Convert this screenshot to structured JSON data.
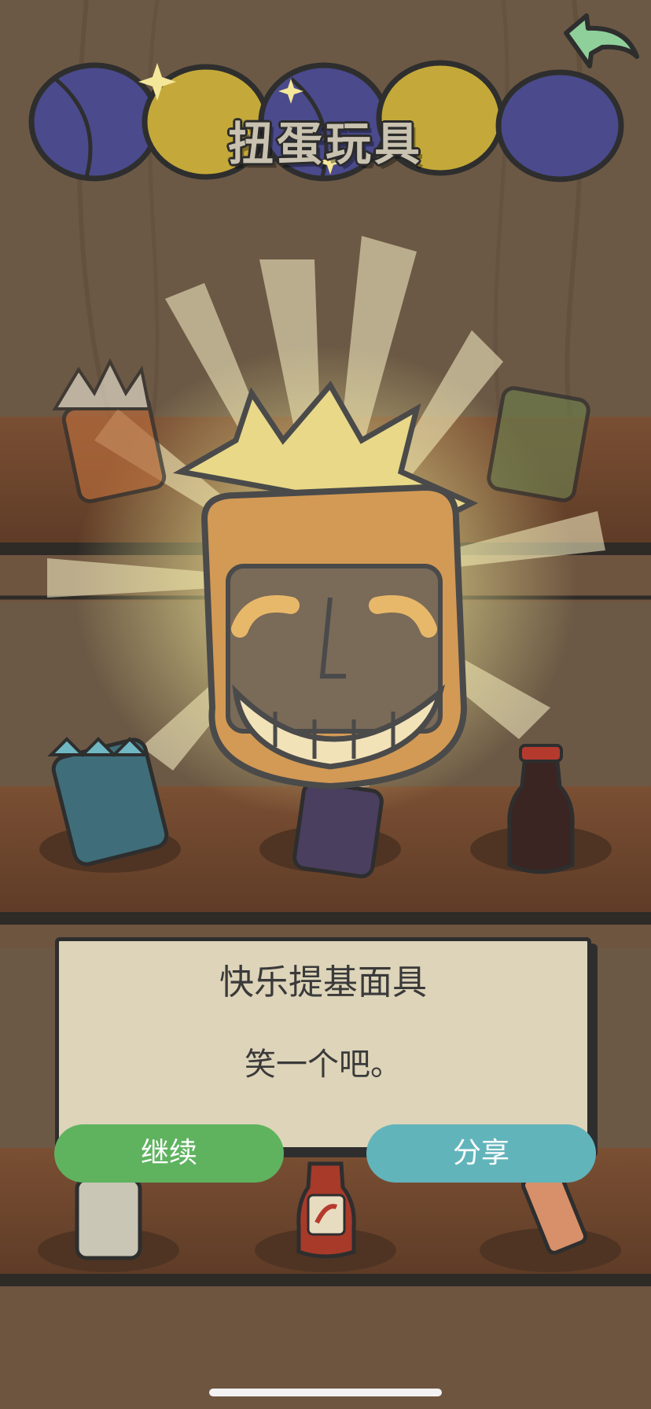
{
  "header": {
    "title": "扭蛋玩具",
    "back_icon": "back-arrow-icon"
  },
  "colors": {
    "background": "#6b5844",
    "dialog_bg": "#ddd4b9",
    "continue_button": "#5fb35f",
    "share_button": "#62b4bb",
    "capsule_blue": "#4a4a8c",
    "capsule_yellow": "#c4a93a"
  },
  "shelf_items": [
    {
      "name": "tiki-mask-orange",
      "icon": "tiki-mask-icon"
    },
    {
      "name": "tiki-mask-silhouette",
      "icon": "tiki-mask-icon"
    },
    {
      "name": "tiki-mask-green",
      "icon": "tiki-mask-icon"
    },
    {
      "name": "tiki-mask-blue",
      "icon": "tiki-mask-icon"
    },
    {
      "name": "tiki-mask-purple",
      "icon": "tiki-mask-icon"
    },
    {
      "name": "soy-sauce-bottle",
      "icon": "soy-sauce-icon"
    },
    {
      "name": "white-bottle",
      "icon": "bottle-icon"
    },
    {
      "name": "hot-sauce-bottle",
      "icon": "hot-sauce-icon"
    },
    {
      "name": "condiment-tube",
      "icon": "tube-icon"
    }
  ],
  "featured": {
    "icon": "happy-tiki-mask-icon"
  },
  "dialog": {
    "title": "快乐提基面具",
    "description": "笑一个吧。",
    "continue_label": "继续",
    "share_label": "分享"
  }
}
